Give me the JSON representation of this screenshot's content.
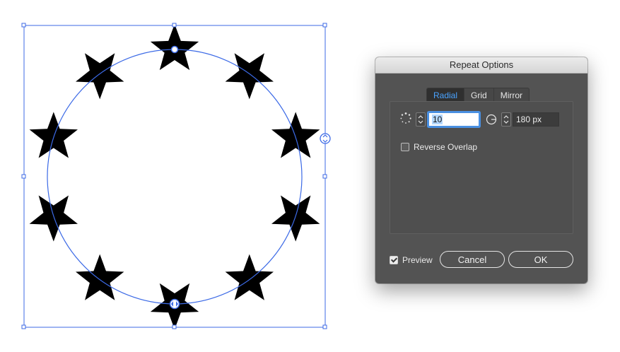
{
  "canvas": {
    "star_count": 10,
    "ring_color": "#3c6ae6",
    "star_color": "#000000"
  },
  "dialog": {
    "title": "Repeat Options",
    "tabs": [
      {
        "label": "Radial",
        "active": true
      },
      {
        "label": "Grid",
        "active": false
      },
      {
        "label": "Mirror",
        "active": false
      }
    ],
    "count_value": "10",
    "radius_value": "180 px",
    "reverse_overlap_label": "Reverse Overlap",
    "reverse_overlap_checked": false,
    "preview_label": "Preview",
    "preview_checked": true,
    "cancel_label": "Cancel",
    "ok_label": "OK",
    "accent_color": "#4aa3ff"
  }
}
